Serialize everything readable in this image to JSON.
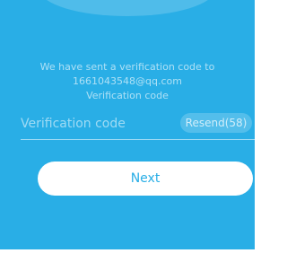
{
  "colors": {
    "background": "#29aee6",
    "button_bg": "#ffffff",
    "button_text": "#29aee6"
  },
  "message": {
    "line1": "We have sent a verification code to",
    "line2": "1661043548@qq.com",
    "line3": "Verification code"
  },
  "verification": {
    "placeholder": "Verification code",
    "value": "",
    "resend_label": "Resend(58)"
  },
  "actions": {
    "next_label": "Next"
  }
}
